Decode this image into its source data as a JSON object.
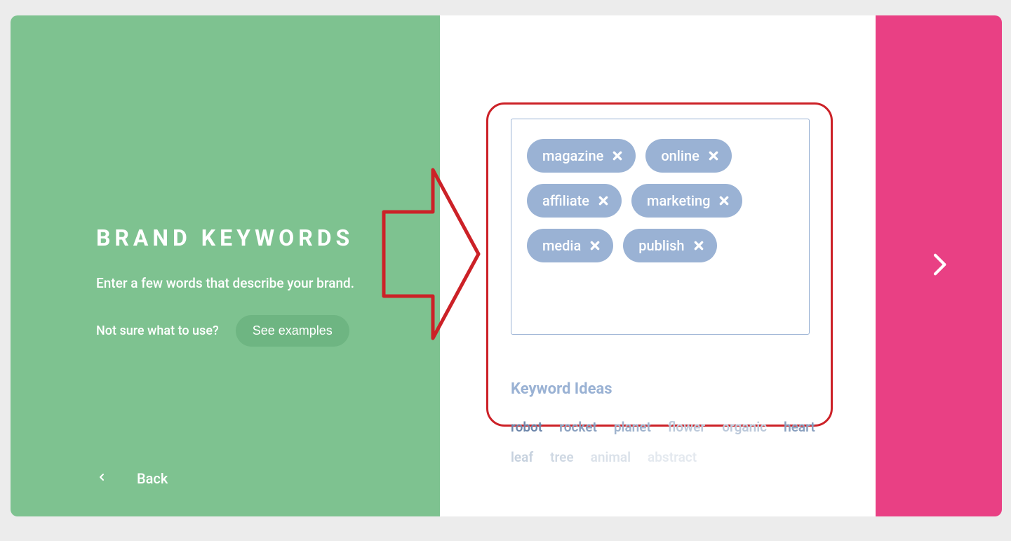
{
  "left": {
    "heading": "Brand Keywords",
    "subheading": "Enter a few words that describe your brand.",
    "prompt": "Not sure what to use?",
    "examples_btn": "See examples",
    "back_label": "Back"
  },
  "keywords": [
    {
      "label": "magazine"
    },
    {
      "label": "online"
    },
    {
      "label": "affiliate"
    },
    {
      "label": "marketing"
    },
    {
      "label": "media"
    },
    {
      "label": "publish"
    }
  ],
  "ideas": {
    "title": "Keyword Ideas",
    "items": [
      {
        "label": "robot",
        "color": "#6e87ab"
      },
      {
        "label": "rocket",
        "color": "#8aa0bf"
      },
      {
        "label": "planet",
        "color": "#9fb3cd"
      },
      {
        "label": "flower",
        "color": "#bcc9da"
      },
      {
        "label": "organic",
        "color": "#bcc9da"
      },
      {
        "label": "heart",
        "color": "#8aa0bf"
      },
      {
        "label": "leaf",
        "color": "#c6d1de"
      },
      {
        "label": "tree",
        "color": "#cfd8e3"
      },
      {
        "label": "animal",
        "color": "#dbe2ea"
      },
      {
        "label": "abstract",
        "color": "#e4e9ef"
      }
    ]
  },
  "colors": {
    "green": "#7ec290",
    "pink": "#e94084",
    "chip": "#9ab2d4",
    "annotation": "#cc2127"
  }
}
